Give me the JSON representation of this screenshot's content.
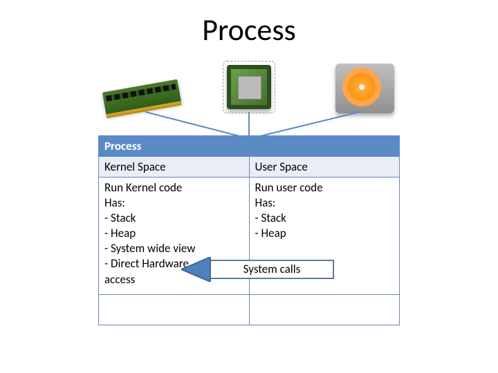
{
  "title": "Process",
  "hardware": {
    "items": [
      "ram",
      "cpu",
      "hdd"
    ]
  },
  "table": {
    "header": "Process",
    "columns": [
      "Kernel Space",
      "User Space"
    ],
    "cells": {
      "kernel": "Run Kernel code\nHas:\n-   Stack\n-   Heap\n-   System wide view\n-   Direct Hardware\n    access",
      "user": "Run user code\nHas:\n-   Stack\n-   Heap"
    }
  },
  "arrow_label": "System calls",
  "colors": {
    "table_header_bg": "#5b8ac6",
    "table_sub_bg": "#e9edf5",
    "arrow_fill": "#4f81bd",
    "arrow_stroke": "#385d8a"
  }
}
